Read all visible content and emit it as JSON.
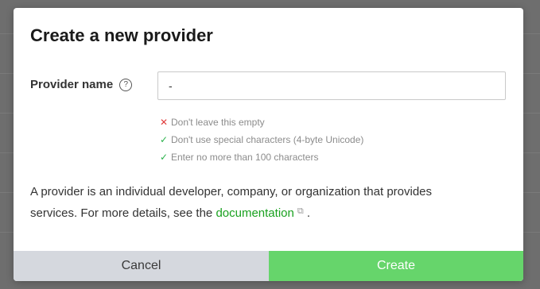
{
  "dialog": {
    "title": "Create a new provider",
    "field": {
      "label": "Provider name",
      "help_icon": "question-circle-icon",
      "value": "-",
      "placeholder": ""
    },
    "rules": [
      {
        "status": "error",
        "icon": "x-icon",
        "icon_glyph": "✕",
        "text": "Don't leave this empty"
      },
      {
        "status": "ok",
        "icon": "check-icon",
        "icon_glyph": "✓",
        "text": "Don't use special characters (4-byte Unicode)"
      },
      {
        "status": "ok",
        "icon": "check-icon",
        "icon_glyph": "✓",
        "text": "Enter no more than 100 characters"
      }
    ],
    "description": {
      "text_before": "A provider is an individual developer, company, or organization that provides services. For more details, see the ",
      "link_text": "documentation",
      "text_after": " ."
    },
    "buttons": {
      "cancel_label": "Cancel",
      "create_label": "Create"
    }
  },
  "colors": {
    "accent_green": "#66d56b",
    "link_green": "#19a11f",
    "error_red": "#e03c3c",
    "success_green": "#2bb24c",
    "cancel_bg": "#d5d8de"
  }
}
